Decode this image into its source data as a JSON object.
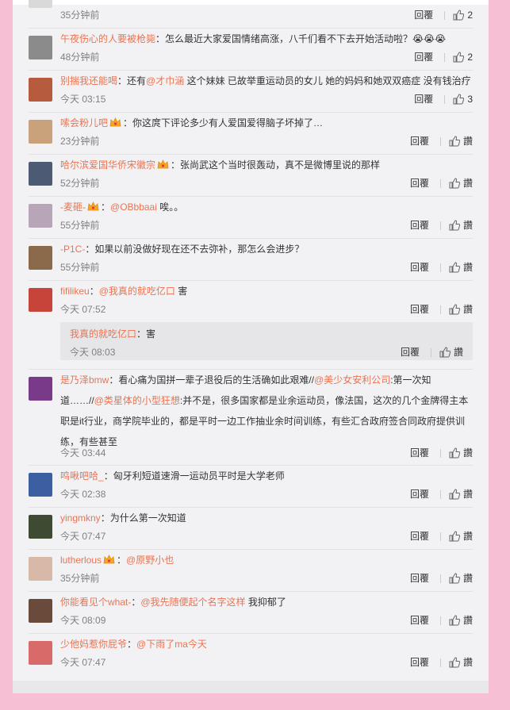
{
  "labels": {
    "reply": "回覆",
    "like": "讚"
  },
  "comments": [
    {
      "user": "",
      "sep": "",
      "content": "",
      "time": "35分钟前",
      "likes": "2",
      "avatar_color": "#d9d9d9"
    },
    {
      "user": "午夜伤心的人要被枪毙",
      "sep": "：",
      "content": "怎么最近大家爱国情绪高涨，八千们看不下去开始活动啦？😭😭😭",
      "time": "48分钟前",
      "likes": "2",
      "avatar_color": "#8b8b8b"
    },
    {
      "user": "别揣我还能喝",
      "sep": "：",
      "pre": "还有",
      "mention": "@才巾涵",
      "content": " 这个妹妹 已故举重运动员的女儿 她的妈妈和她双双癌症 没有钱治疗",
      "time": "今天 03:15",
      "likes": "3",
      "avatar_color": "#b75b3f"
    },
    {
      "user": "嗦会粉儿吧",
      "sep": "：",
      "content": "你这庹下评论多少有人爱国爱得脑子坏掉了…",
      "time": "23分钟前",
      "likes": "讚",
      "avatar_color": "#c9a27b"
    },
    {
      "user": "哈尔滨爱国华侨宋徽宗",
      "sep": "：",
      "content": "张尚武这个当时很轰动，真不是微博里说的那样",
      "time": "52分钟前",
      "likes": "讚",
      "avatar_color": "#4c5a73"
    },
    {
      "user": "-麦砸-",
      "sep": "：",
      "mention": "@OBbbaai",
      "content": " 唉。。",
      "time": "55分钟前",
      "likes": "讚",
      "avatar_color": "#b8a5b7"
    },
    {
      "user": "-P1C-",
      "sep": "：",
      "content": "如果以前没做好现在还不去弥补，那怎么会进步？",
      "time": "55分钟前",
      "likes": "讚",
      "avatar_color": "#8a6a4a"
    },
    {
      "user": "fifilikeu",
      "sep": "：",
      "mention": "@我真的就吃亿口",
      "content": " 害",
      "time": "今天 07:52",
      "likes": "讚",
      "avatar_color": "#c7443a"
    },
    {
      "user": "我真的就吃亿口",
      "sep": "：",
      "content": "害",
      "time": "今天 08:03",
      "likes": "讚"
    },
    {
      "user": "是乃泽bmw",
      "sep": "：",
      "line1": "看心痛为国拼一辈子退役后的生活确如此艰难//",
      "mention1": "@美少女安利公司",
      "line1b": ":第一次知",
      "line2a": "道……//",
      "mention2": "@类星体的小型狂想",
      "line2b": ":并不是，很多国家都是业余运动员，像法国，这次的几个金牌得主本",
      "line3": "职是it行业，商学院毕业的，都是平时一边工作抽业余时间训练，有些汇合政府签合同政府提供训",
      "line4": "练，有些甚至",
      "time": "今天 03:44",
      "likes": "讚",
      "avatar_color": "#7a3a8a"
    },
    {
      "user": "鸣啾吧哈_",
      "sep": "：",
      "content": "匈牙利短道速滑一运动员平时是大学老师",
      "time": "今天 02:38",
      "likes": "讚",
      "avatar_color": "#3b5fa0"
    },
    {
      "user": "yingmkny",
      "sep": "：",
      "content": "为什么第一次知道",
      "time": "今天 07:47",
      "likes": "讚",
      "avatar_color": "#3f4a32"
    },
    {
      "user": "lutherlous",
      "sep": "：",
      "mention": "@原野小也",
      "content": "",
      "time": "35分钟前",
      "likes": "讚",
      "avatar_color": "#d8b9a8"
    },
    {
      "user": "你能看见个what-",
      "sep": "：",
      "mention": "@我先随便起个名字这样",
      "content": " 我抑郁了",
      "time": "今天 08:09",
      "likes": "讚",
      "avatar_color": "#6a4a3a"
    },
    {
      "user": "少他妈惹你屁爷",
      "sep": "：",
      "mention": "@下雨了ma今天",
      "content": "",
      "time": "今天 07:47",
      "likes": "讚",
      "avatar_color": "#d86a6a"
    }
  ]
}
